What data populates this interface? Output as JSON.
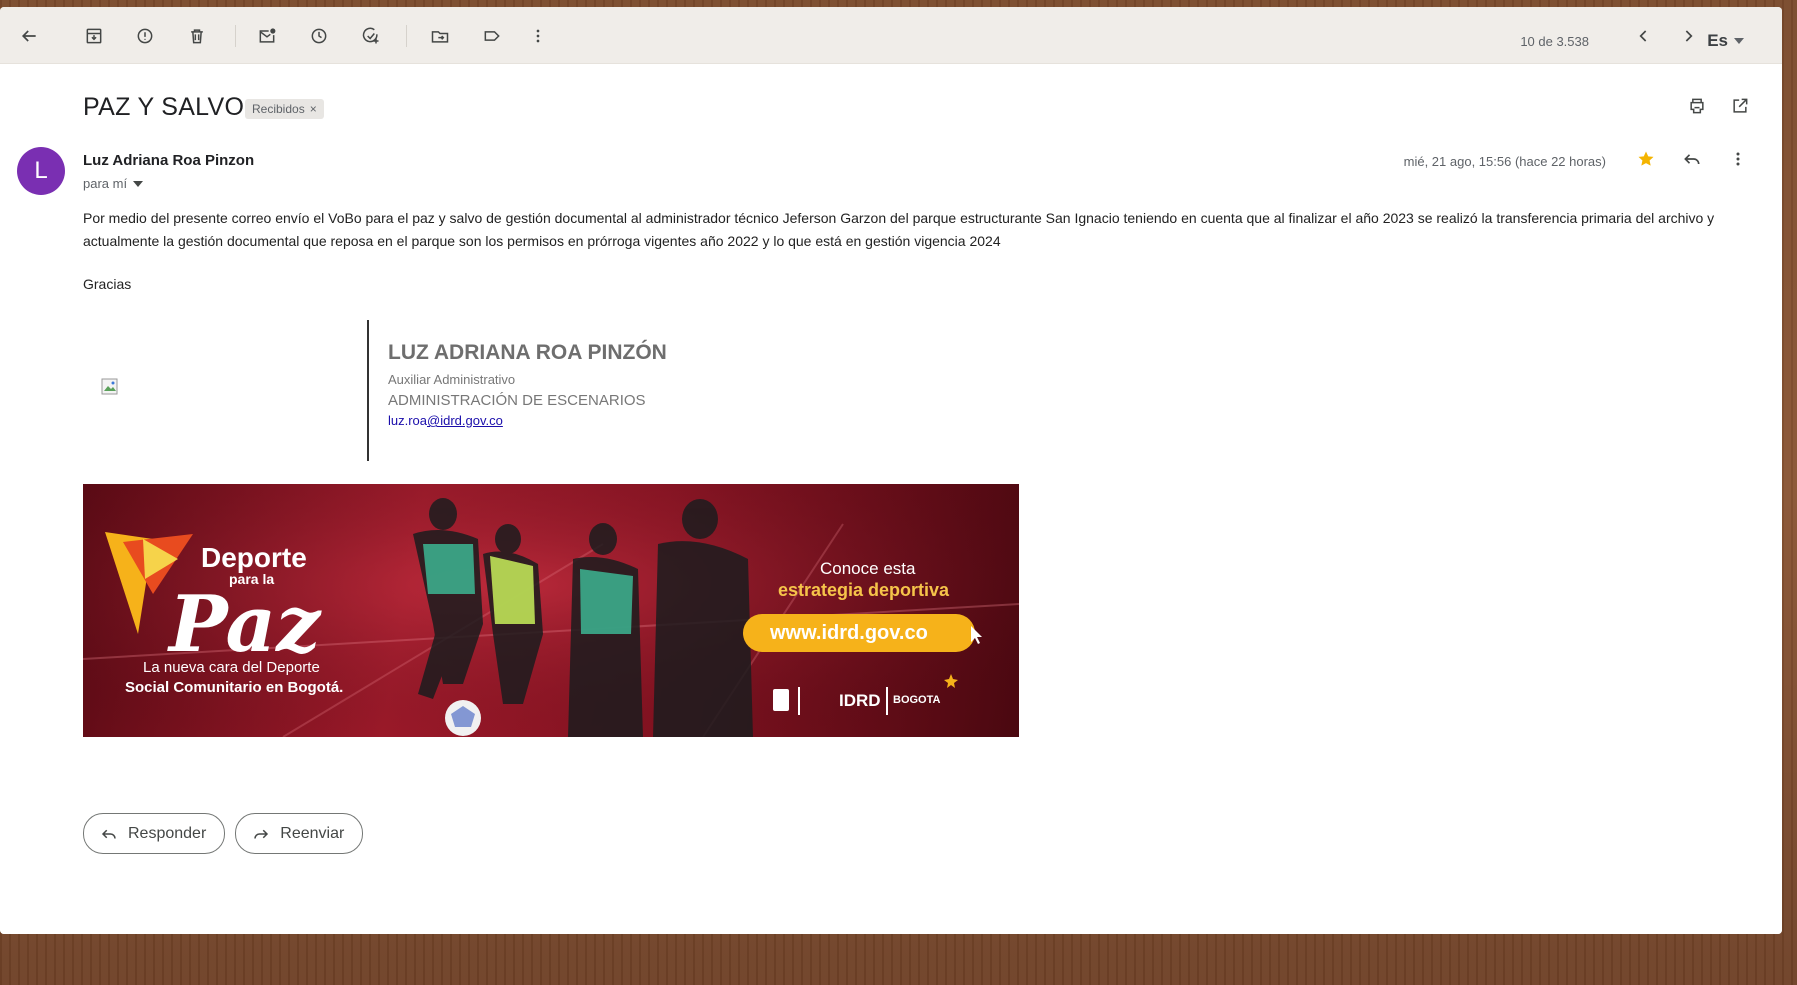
{
  "toolbar": {
    "pager": "10 de 3.538",
    "lang": "Es",
    "icons": [
      "back-arrow-icon",
      "archive-icon",
      "report-spam-icon",
      "delete-icon",
      "mark-unread-icon",
      "snooze-icon",
      "add-task-icon",
      "move-to-icon",
      "label-icon",
      "more-vert-icon"
    ]
  },
  "email": {
    "subject": "PAZ Y SALVO",
    "label": "Recibidos",
    "label_close": "×",
    "avatar_letter": "L",
    "sender": "Luz Adriana Roa Pinzon",
    "recipient": "para mí",
    "date": "mié, 21 ago, 15:56 (hace 22 horas)",
    "body": "Por medio del presente correo envío el VoBo para el paz y salvo de gestión documental al administrador  técnico Jeferson Garzon  del parque estructurante San Ignacio teniendo en cuenta que al finalizar el año 2023 se realizó la transferencia primaria del archivo  y actualmente la gestión documental que reposa en el parque son los permisos en prórroga vigentes año 2022 y lo que está en gestión vigencia 2024",
    "thanks": "Gracias"
  },
  "signature": {
    "name": "LUZ ADRIANA ROA PINZÓN",
    "role": "Auxiliar Administrativo",
    "department": "ADMINISTRACIÓN DE ESCENARIOS",
    "email_user": "luz.roa",
    "email_domain": "@idrd.gov.co"
  },
  "banner": {
    "title_1": "Deporte",
    "title_2": "para la",
    "title_3": "Paz",
    "tagline_1": "La nueva cara del Deporte",
    "tagline_2": "Social Comunitario en Bogotá.",
    "cta_1": "Conoce esta",
    "cta_2": "estrategia deportiva",
    "url": "www.idrd.gov.co",
    "logo_idrd": "IDRD",
    "logo_bogota": "BOGOTA"
  },
  "actions": {
    "reply": "Responder",
    "forward": "Reenviar"
  },
  "colors": {
    "avatar": "#7a2fb2",
    "star": "#f4b400",
    "banner_red": "#a01a2a",
    "cta_yellow": "#f6b21a"
  }
}
